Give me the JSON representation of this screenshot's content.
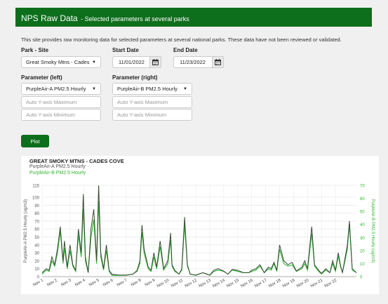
{
  "header": {
    "title": "NPS Raw Data",
    "subtitle": "- Selected parameters at several parks"
  },
  "intro": "This site provides raw monitoring data for selected parameters at several national parks. These data have not been reviewed or validated.",
  "form": {
    "park_site_label": "Park - Site",
    "park_site_value": "Great Smoky Mtns - Cades",
    "start_date_label": "Start Date",
    "start_date_value": "11/01/2022",
    "end_date_label": "End Date",
    "end_date_value": "11/23/2022",
    "param_left_label": "Parameter (left)",
    "param_left_value": "PurpleAir-A PM2.5 Hourly",
    "param_right_label": "Parameter (right)",
    "param_right_value": "PurpleAir-B PM2.5 Hourly",
    "left_ymax_placeholder": "Auto Y-axis Maximum",
    "left_ymin_placeholder": "Auto Y-axis Minimum",
    "right_ymax_placeholder": "Auto Y-axis Maximum",
    "right_ymin_placeholder": "Auto Y-axis Minimum",
    "plot_button": "Plot"
  },
  "colors": {
    "brand": "#0d6e1c",
    "series_a": "#3a4a3a",
    "series_b": "#2fb52f"
  },
  "icons": {
    "calendar": "calendar-icon",
    "dropdown": "caret-down-icon"
  },
  "chart_data": {
    "type": "line",
    "title": "GREAT SMOKY MTNS - CADES COVE",
    "legend": [
      "PurpleAir-A PM2.5 Hourly",
      "PurpleAir-B PM2.5 Hourly"
    ],
    "ylabel_left": "PurpleAir-A PM2.5 Hourly (ug/m3)",
    "ylabel_right": "PurpleAir-B PM2.5 Hourly (ug/m3)",
    "ylim_left": [
      0,
      115
    ],
    "ylim_right": [
      0,
      70
    ],
    "yticks_left": [
      0,
      10,
      20,
      30,
      40,
      50,
      60,
      70,
      80,
      90,
      100,
      115
    ],
    "yticks_right": [
      0,
      10,
      20,
      30,
      40,
      50,
      60,
      70
    ],
    "x_labels": [
      "Nov 1",
      "Nov 2",
      "Nov 3",
      "Nov 4",
      "Nov 5",
      "Nov 6",
      "Nov 7",
      "Nov 8",
      "Nov 9",
      "Nov 10",
      "Nov 11",
      "Nov 12",
      "Nov 13",
      "Nov 14",
      "Nov 15",
      "Nov 16",
      "Nov 17",
      "Nov 18",
      "Nov 19",
      "Nov 20",
      "Nov 21",
      "Nov 22"
    ],
    "x_range": [
      0,
      22.5
    ],
    "grid": true,
    "series": [
      {
        "name": "PurpleAir-A PM2.5 Hourly",
        "x": [
          0,
          0.3,
          0.5,
          0.7,
          0.9,
          1.1,
          1.3,
          1.5,
          1.6,
          1.8,
          2.0,
          2.2,
          2.4,
          2.6,
          2.8,
          2.95,
          3.1,
          3.3,
          3.5,
          3.7,
          3.9,
          4.05,
          4.2,
          4.4,
          4.6,
          4.8,
          5.0,
          5.5,
          6.0,
          6.5,
          6.8,
          7.0,
          7.15,
          7.3,
          7.6,
          7.8,
          8.0,
          8.2,
          8.45,
          8.7,
          9.0,
          9.2,
          9.3,
          9.5,
          9.8,
          10.0,
          10.2,
          10.4,
          10.6,
          11.0,
          11.5,
          11.8,
          12.0,
          12.3,
          12.6,
          13.0,
          13.3,
          13.6,
          14.0,
          14.4,
          14.8,
          15.0,
          15.3,
          15.6,
          15.9,
          16.2,
          16.4,
          16.6,
          16.8,
          17.0,
          17.3,
          17.6,
          17.9,
          18.2,
          18.6,
          18.8,
          19.0,
          19.3,
          19.5,
          19.8,
          20.0,
          20.3,
          20.6,
          20.8,
          21.0,
          21.2,
          21.35,
          21.5,
          21.7,
          21.85,
          22.0,
          22.2,
          22.5
        ],
        "y": [
          5,
          10,
          8,
          25,
          15,
          35,
          63,
          20,
          45,
          12,
          40,
          15,
          8,
          60,
          30,
          104,
          25,
          5,
          60,
          85,
          20,
          115,
          30,
          10,
          40,
          8,
          3,
          2,
          2,
          3,
          8,
          20,
          65,
          35,
          12,
          8,
          30,
          12,
          45,
          10,
          20,
          55,
          15,
          8,
          3,
          10,
          75,
          15,
          3,
          2,
          5,
          3,
          2,
          8,
          10,
          7,
          3,
          9,
          8,
          5,
          5,
          8,
          10,
          15,
          5,
          12,
          10,
          18,
          8,
          40,
          20,
          15,
          18,
          7,
          12,
          20,
          10,
          63,
          15,
          8,
          4,
          10,
          5,
          20,
          8,
          30,
          15,
          5,
          25,
          40,
          70,
          10,
          5
        ]
      },
      {
        "name": "PurpleAir-B PM2.5 Hourly",
        "x": [
          0,
          0.3,
          0.5,
          0.7,
          0.9,
          1.1,
          1.3,
          1.5,
          1.6,
          1.8,
          2.0,
          2.2,
          2.4,
          2.6,
          2.8,
          2.95,
          3.1,
          3.3,
          3.5,
          3.7,
          3.9,
          4.05,
          4.2,
          4.4,
          4.6,
          4.8,
          5.0,
          5.5,
          6.0,
          6.5,
          6.8,
          7.0,
          7.15,
          7.3,
          7.6,
          7.8,
          8.0,
          8.2,
          8.45,
          8.7,
          9.0,
          9.2,
          9.3,
          9.5,
          9.8,
          10.0,
          10.2,
          10.4,
          10.6,
          11.0,
          11.5,
          11.8,
          12.0,
          12.3,
          12.6,
          13.0,
          13.3,
          13.6,
          14.0,
          14.4,
          14.8,
          15.0,
          15.3,
          15.6,
          15.9,
          16.2,
          16.4,
          16.6,
          16.8,
          17.0,
          17.3,
          17.6,
          17.9,
          18.2,
          18.6,
          18.8,
          19.0,
          19.3,
          19.5,
          19.8,
          20.0,
          20.3,
          20.6,
          20.8,
          21.0,
          21.2,
          21.35,
          21.5,
          21.7,
          21.85,
          22.0,
          22.2,
          22.5
        ],
        "y": [
          2,
          5,
          4,
          12,
          8,
          18,
          35,
          10,
          22,
          6,
          20,
          8,
          4,
          32,
          15,
          52,
          12,
          3,
          30,
          44,
          10,
          58,
          15,
          5,
          20,
          4,
          1,
          1,
          1,
          2,
          4,
          10,
          34,
          18,
          6,
          4,
          15,
          6,
          23,
          5,
          10,
          28,
          8,
          4,
          2,
          5,
          40,
          8,
          2,
          1,
          3,
          2,
          1,
          4,
          5,
          4,
          2,
          5,
          4,
          3,
          3,
          4,
          5,
          8,
          3,
          6,
          5,
          10,
          4,
          21,
          10,
          8,
          9,
          4,
          6,
          10,
          5,
          33,
          8,
          4,
          2,
          5,
          3,
          10,
          4,
          16,
          8,
          3,
          13,
          21,
          40,
          5,
          3
        ]
      }
    ]
  }
}
